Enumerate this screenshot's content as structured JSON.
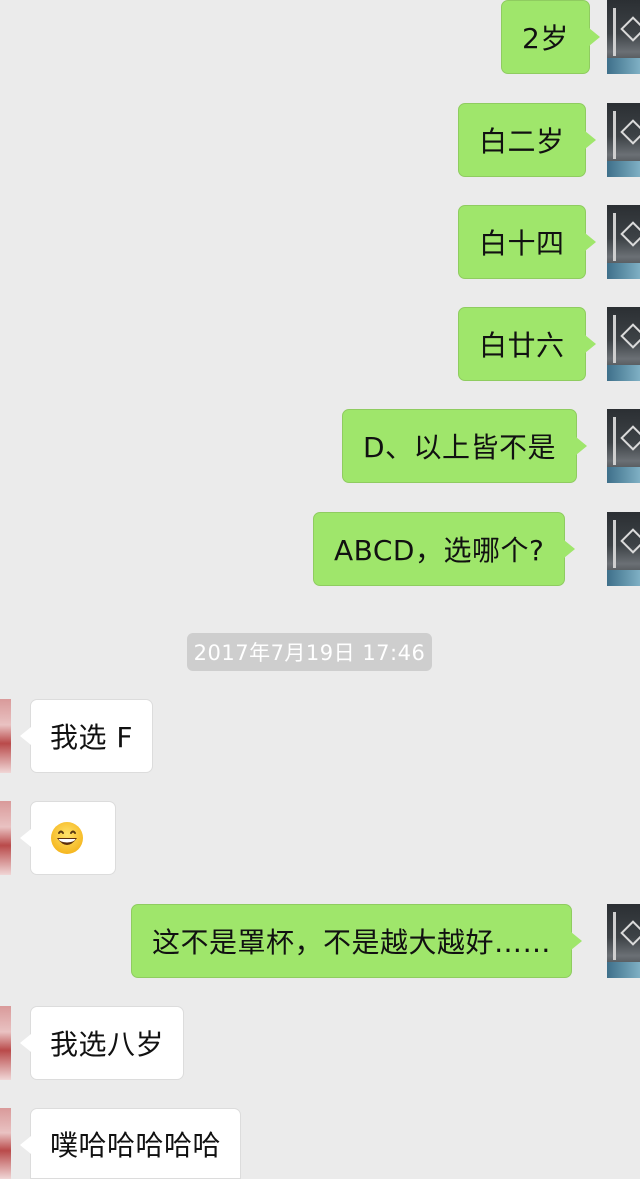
{
  "messages": {
    "m1": "2岁",
    "m2": "白二岁",
    "m3": "白十四",
    "m4": "白廿六",
    "m5": "D、以上皆不是",
    "m6": "ABCD，选哪个?",
    "m7": "我选 F",
    "m9": "这不是罩杯，不是越大越好……",
    "m10": "我选八岁",
    "m11": "噗哈哈哈哈哈"
  },
  "timestamp": "2017年7月19日 17:46",
  "icons": {
    "emoji": "grinning-face-emoji",
    "avatar_self": "user-avatar-icon",
    "avatar_other": "contact-avatar-icon"
  },
  "colors": {
    "background": "#ebebeb",
    "outgoing_bubble": "#9fe66b",
    "incoming_bubble": "#ffffff",
    "timestamp_bg": "#cecece"
  }
}
